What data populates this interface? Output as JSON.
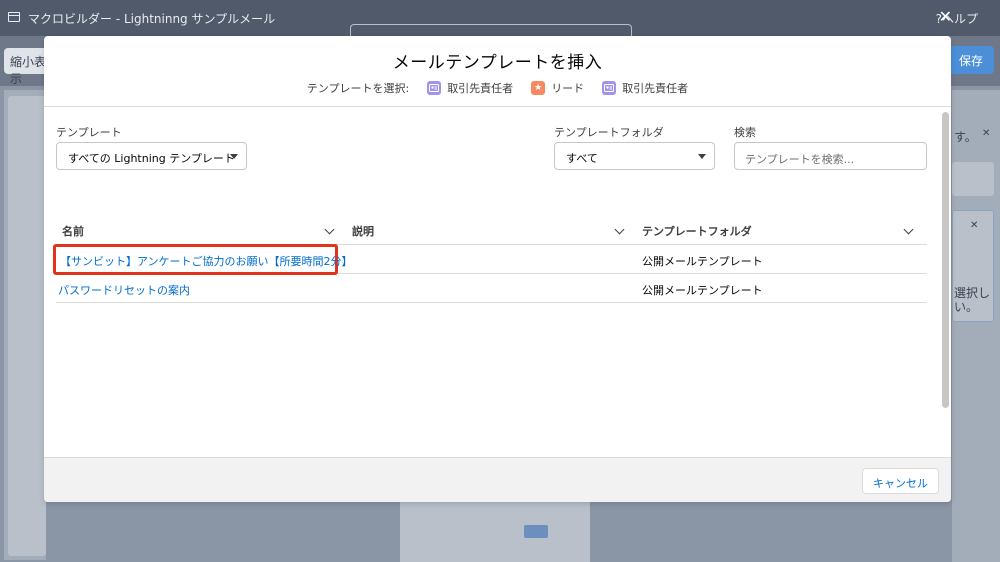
{
  "app": {
    "title": "マクロビルダー - Lightninng サンプルメール",
    "help": "?ヘルプ",
    "close_glyph": "✕",
    "shrink_button": "縮小表示",
    "save_button": "保存",
    "right_panel_text_1": "す。",
    "right_panel_text_2": "選択し",
    "right_panel_text_3": "い。",
    "right_close_glyph": "✕"
  },
  "modal": {
    "title": "メールテンプレートを挿入",
    "type_selector": {
      "label": "テンプレートを選択:",
      "options": [
        {
          "icon": "contact-card-icon",
          "label": "取引先責任者"
        },
        {
          "icon": "lead-star-icon",
          "label": "リード"
        },
        {
          "icon": "contact-card-icon",
          "label": "取引先責任者"
        }
      ]
    },
    "template_field": {
      "label": "テンプレート",
      "value": "すべての Lightning テンプレート"
    },
    "folder_field": {
      "label": "テンプレートフォルダ",
      "value": "すべて"
    },
    "search_field": {
      "label": "検索",
      "placeholder": "テンプレートを検索..."
    },
    "table": {
      "columns": [
        "名前",
        "説明",
        "テンプレートフォルダ"
      ],
      "rows": [
        {
          "name": "【サンビット】アンケートご協力のお願い【所要時間2分】",
          "description": "",
          "folder": "公開メールテンプレート"
        },
        {
          "name": "パスワードリセットの案内",
          "description": "",
          "folder": "公開メールテンプレート"
        }
      ]
    },
    "cancel_button": "キャンセル"
  },
  "colors": {
    "overlay": "#8a95a6",
    "link": "#006dcc",
    "highlight": "#e0341c",
    "contact_icon": "#a094ed",
    "lead_icon": "#f88962"
  }
}
